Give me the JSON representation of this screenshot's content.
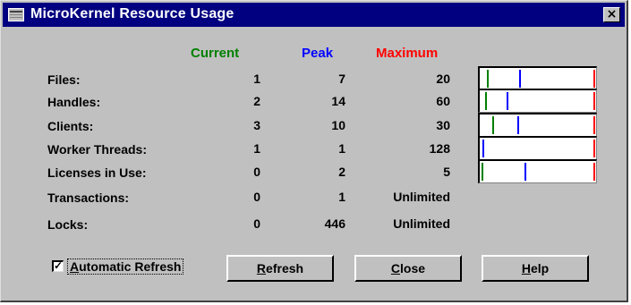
{
  "window": {
    "title": "MicroKernel Resource Usage",
    "close_glyph": "×"
  },
  "headers": {
    "current": "Current",
    "peak": "Peak",
    "maximum": "Maximum"
  },
  "colors": {
    "current": "#008000",
    "peak": "#0000ff",
    "maximum": "#ff0000",
    "titlebar": "#000080",
    "face": "#c0c0c0"
  },
  "rows": [
    {
      "label": "Files:",
      "current": "1",
      "peak": "7",
      "maximum": "20",
      "meter": {
        "current": 0.05,
        "peak": 0.35
      }
    },
    {
      "label": "Handles:",
      "current": "2",
      "peak": "14",
      "maximum": "60",
      "meter": {
        "current": 0.03,
        "peak": 0.23
      }
    },
    {
      "label": "Clients:",
      "current": "3",
      "peak": "10",
      "maximum": "30",
      "meter": {
        "current": 0.1,
        "peak": 0.33
      }
    },
    {
      "label": "Worker Threads:",
      "current": "1",
      "peak": "1",
      "maximum": "128",
      "meter": {
        "current": 0.008,
        "peak": 0.008
      }
    },
    {
      "label": "Licenses in Use:",
      "current": "0",
      "peak": "2",
      "maximum": "5",
      "meter": {
        "current": 0.0,
        "peak": 0.4
      }
    },
    {
      "label": "Transactions:",
      "current": "0",
      "peak": "1",
      "maximum": "Unlimited"
    },
    {
      "label": "Locks:",
      "current": "0",
      "peak": "446",
      "maximum": "Unlimited"
    }
  ],
  "auto_refresh": {
    "label_accel": "A",
    "label_rest": "utomatic Refresh",
    "checked": true,
    "check_glyph": "✓"
  },
  "buttons": {
    "refresh": {
      "accel": "R",
      "rest": "efresh"
    },
    "close": {
      "accel": "C",
      "rest": "lose"
    },
    "help": {
      "accel": "H",
      "rest": "elp"
    }
  }
}
